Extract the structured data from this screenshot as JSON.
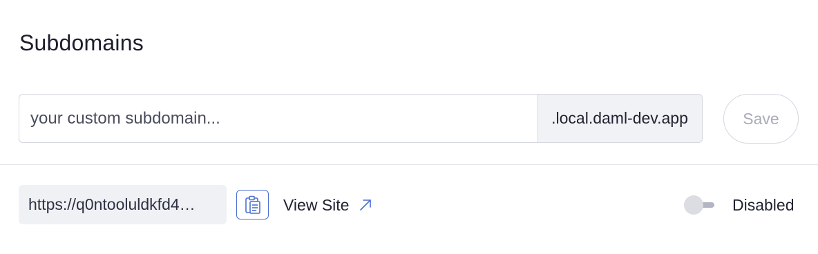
{
  "section": {
    "title": "Subdomains"
  },
  "subdomain_form": {
    "input_value": "",
    "input_placeholder": "your custom subdomain...",
    "suffix": ".local.daml-dev.app",
    "save_label": "Save"
  },
  "site": {
    "url": "https://q0ntooluldkfd4…",
    "copy_icon": "clipboard-icon",
    "view_site_label": "View Site",
    "view_site_icon": "arrow-up-right-icon"
  },
  "status": {
    "enabled": false,
    "label": "Disabled"
  },
  "colors": {
    "accent": "#4a6fd1",
    "input_addon_bg": "#f1f2f5",
    "url_box_bg": "#f0f1f5",
    "save_disabled_text": "#a9acb8",
    "toggle_track": "#b3b6c2",
    "toggle_knob": "#dcdde3"
  }
}
